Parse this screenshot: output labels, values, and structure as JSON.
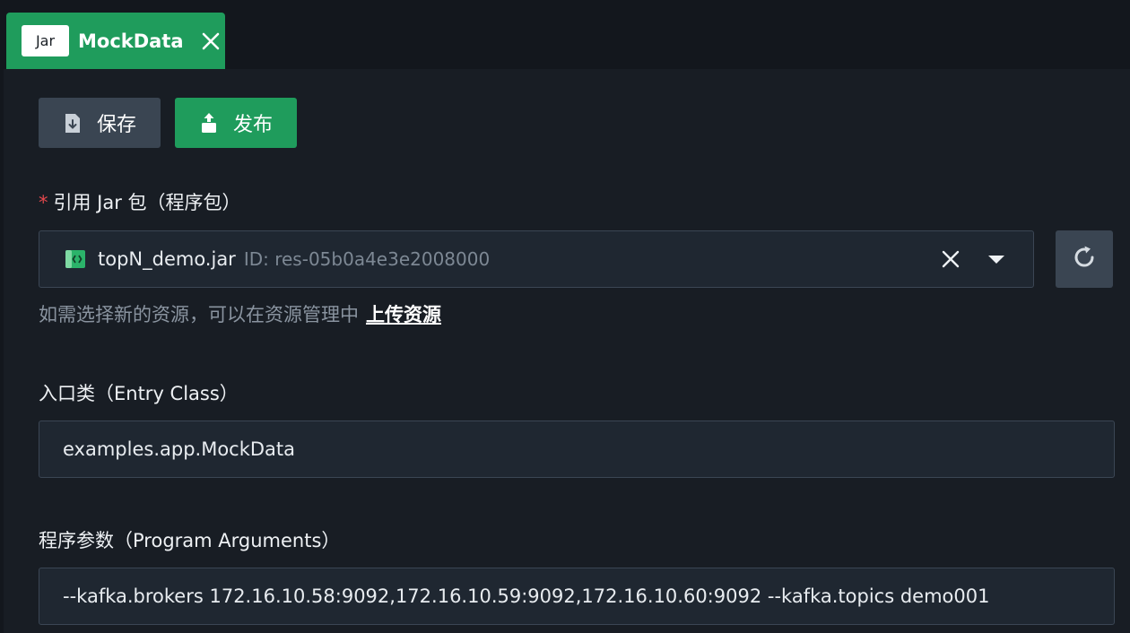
{
  "tab": {
    "badge": "Jar",
    "title": "MockData"
  },
  "toolbar": {
    "save_label": "保存",
    "publish_label": "发布"
  },
  "jar_field": {
    "required_mark": "*",
    "label": "引用 Jar 包（程序包）",
    "selected_name": "topN_demo.jar",
    "selected_id": "ID: res-05b0a4e3e2008000",
    "hint": "如需选择新的资源，可以在资源管理中",
    "hint_link": "上传资源"
  },
  "entry_class": {
    "label": "入口类（Entry Class）",
    "value": "examples.app.MockData"
  },
  "program_args": {
    "label": "程序参数（Program Arguments）",
    "value": "--kafka.brokers 172.16.10.58:9092,172.16.10.59:9092,172.16.10.60:9092 --kafka.topics demo001"
  },
  "colors": {
    "accent": "#1f9c5c",
    "background": "#181d24",
    "field": "#1f2731",
    "required": "#e5484d"
  },
  "icons": {
    "save": "file-download-icon",
    "publish": "upload-icon",
    "jar": "code-file-icon",
    "clear": "close-icon",
    "caret": "caret-down-icon",
    "refresh": "refresh-icon",
    "tab_close": "close-icon"
  }
}
